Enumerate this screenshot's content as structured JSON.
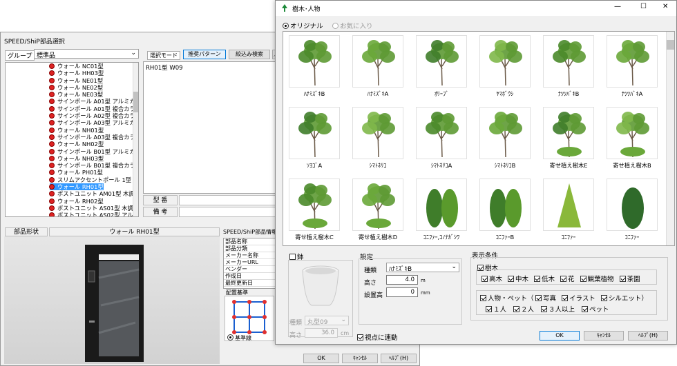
{
  "back_window": {
    "title": "SPEED/ShiP部品選択",
    "group_label": "グループ",
    "group_value": "標準品",
    "mode_label": "選択モード",
    "tabs": [
      "推奨パターン",
      "絞込み検索",
      "／"
    ],
    "tree_items": [
      "ウォール NC01型",
      "ウォール HH03型",
      "ウォール NE01型",
      "ウォール NE02型",
      "ウォール NE03型",
      "サインポール A01型 アルミカラ",
      "サインポール A01型 複合カラー",
      "サインポール A02型 複合カラー",
      "サインポール A03型 アルミカラ",
      "ウォール NH01型",
      "サインポール A03型 複合カラー",
      "ウォール NH02型",
      "サインポール B01型 アルミカラ",
      "ウォール NH03型",
      "サインポール B01型 複合カラー",
      "ウォール PH01型",
      "スリムアクセントポール 1型",
      "ウォール RH01型",
      "ポストユニット AM01型 木調カラ",
      "ウォール RH02型",
      "ポストユニット AS01型 木調カラ",
      "ポストユニット AS02型 アルミ木"
    ],
    "tree_selected_index": 17,
    "pattern_list": [
      "RH01型 W09"
    ],
    "model_label": "型 番",
    "note_label": "備 考",
    "shape_label": "部品形状",
    "shape_value": "ウォール RH01型",
    "info_title": "SPEED/ShiP部品情報",
    "info_rows": [
      "部品名称",
      "部品分類",
      "メーカー名称",
      "メーカーURL",
      "ベンダー",
      "作成日",
      "最終更新日"
    ],
    "placement_label": "配置基準",
    "baseline_label": "基準線",
    "buttons": {
      "ok": "OK",
      "cancel": "ｷｬﾝｾﾙ",
      "help": "ﾍﾙﾌﾟ(H)"
    }
  },
  "dialog": {
    "title": "樹木･人物",
    "controls": {
      "minimize": "—",
      "maximize": "☐",
      "close": "✕"
    },
    "radio_original": "オリジナル",
    "radio_favorite": "お気に入り",
    "trees": [
      "ﾊﾅﾐｽﾞｷB",
      "ﾊﾅﾐｽﾞｷA",
      "ｵﾘｰﾌﾞ",
      "ﾔﾏﾎﾞｳｼ",
      "ﾅﾂﾂﾊﾞｷB",
      "ﾅﾂﾂﾊﾞｷA",
      "ｿﾖｺﾞA",
      "ｼﾏﾄﾈﾘｺ",
      "ｼﾏﾄﾈﾘｺA",
      "ｼﾏﾄﾈﾘｺB",
      "寄せ植え樹木E",
      "寄せ植え樹木B",
      "寄せ植え樹木C",
      "寄せ植え樹木D",
      "ｺﾆﾌｧｰ,ｺﾉﾃｶﾞｼﾜ",
      "ｺﾆﾌｧｰB",
      "ｺﾆﾌｧｰ",
      "ｺﾆﾌｧｰ"
    ],
    "pot": {
      "label": "鉢",
      "kind_label": "種類",
      "kind_value": "丸型09",
      "height_label": "高さ",
      "height_value": "36.0",
      "unit": "cm"
    },
    "settings": {
      "title": "設定",
      "kind_label": "種類",
      "kind_value": "ﾊﾅﾐｽﾞｷB",
      "height_label": "高さ",
      "height_value": "4.0",
      "height_unit": "m",
      "offset_label": "設置高",
      "offset_value": "0",
      "offset_unit": "mm"
    },
    "follow_view": "視点に連動",
    "conditions": {
      "title": "表示条件",
      "trees_label": "樹木",
      "tree_types": [
        "高木",
        "中木",
        "低木",
        "花",
        "観葉植物",
        "茶園"
      ],
      "people_label": "人物・ペット（",
      "people_types": [
        "写真",
        "イラスト",
        "シルエット）"
      ],
      "counts": [
        "１人",
        "２人",
        "３人以上",
        "ペット"
      ]
    },
    "buttons": {
      "ok": "OK",
      "cancel": "ｷｬﾝｾﾙ",
      "help": "ﾍﾙﾌﾟ(H)"
    },
    "colors": {
      "accent": "#0078d7",
      "tree_green": "#4a8a2a",
      "conifer": "#3f7d2a"
    }
  }
}
